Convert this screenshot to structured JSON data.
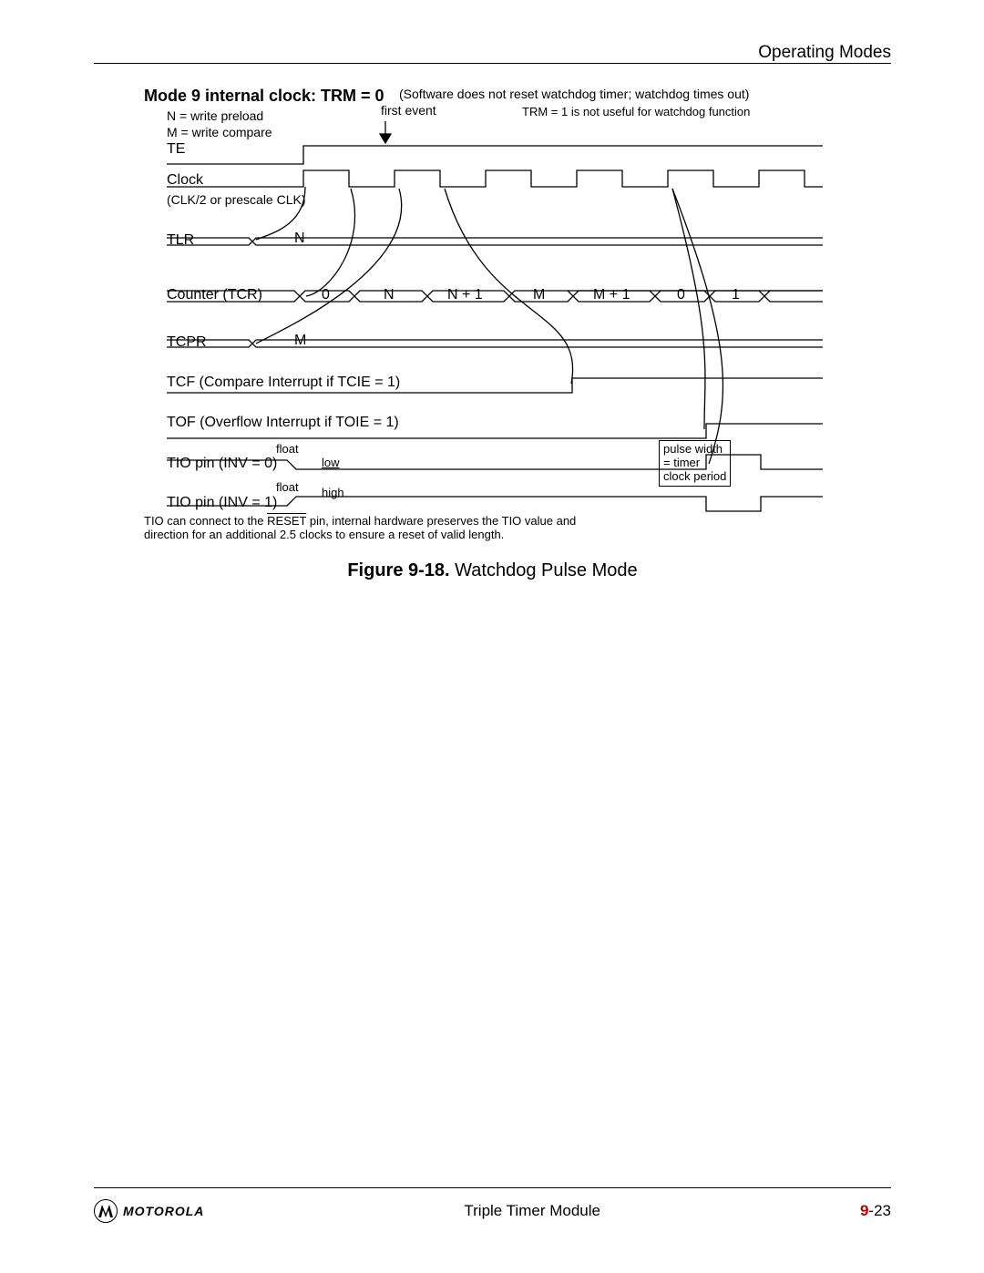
{
  "header": {
    "section": "Operating Modes"
  },
  "figure": {
    "title_mode": "Mode 9 internal clock: TRM = 0",
    "condition": "(Software does not reset watchdog timer; watchdog times out)",
    "first_event": "first event",
    "trm_note": "TRM = 1 is not useful for watchdog function",
    "n_label": "N = write preload",
    "m_label": "M = write compare",
    "signals": {
      "te": "TE",
      "clock": "Clock",
      "clock_sub": "(CLK/2 or prescale CLK)",
      "tlr": "TLR",
      "tlr_val": "N",
      "counter": "Counter (TCR)",
      "counter_vals": [
        "0",
        "N",
        "N + 1",
        "M",
        "M + 1",
        "0",
        "1"
      ],
      "tcpr": "TCPR",
      "tcpr_val": "M",
      "tcf": "TCF (Compare Interrupt if TCIE = 1)",
      "tof": "TOF (Overflow Interrupt if TOIE = 1)",
      "tio0": "TIO pin (INV = 0)",
      "tio0_float": "float",
      "tio0_low": "low",
      "tio1": "TIO pin (INV = 1)",
      "tio1_float": "float",
      "tio1_high": "high",
      "pulse_box_l1": "pulse width",
      "pulse_box_l2": "= timer",
      "pulse_box_l3": "clock period"
    },
    "footnote_l1": "TIO can connect to the RESET pin, internal hardware preserves the TIO value and",
    "footnote_reset": "RESET",
    "footnote_l1_pre": "TIO can connect to the ",
    "footnote_l1_post": " pin, internal hardware preserves the TIO value and",
    "footnote_l2": "direction for an additional 2.5 clocks to ensure a reset of valid length.",
    "caption_label": "Figure 9-18.",
    "caption_title": " Watchdog Pulse Mode"
  },
  "footer": {
    "brand": "MOTOROLA",
    "doc_title": "Triple Timer Module",
    "page_ch": "9",
    "page_sep": "-",
    "page_no": "23"
  }
}
